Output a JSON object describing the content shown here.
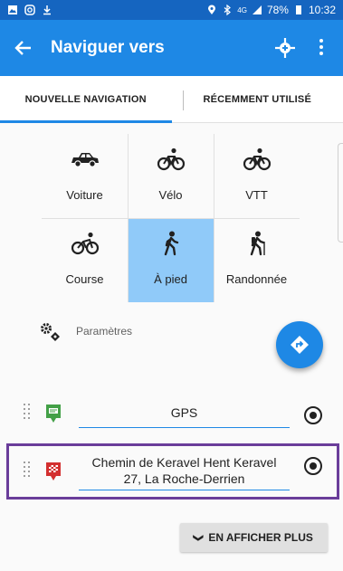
{
  "status_bar": {
    "time": "10:32",
    "battery": "78%",
    "network": "4G"
  },
  "app_bar": {
    "title": "Naviguer vers"
  },
  "tabs": [
    {
      "label": "NOUVELLE NAVIGATION",
      "active": true
    },
    {
      "label": "RÉCEMMENT UTILISÉ",
      "active": false
    }
  ],
  "modes": [
    {
      "label": "Voiture",
      "icon": "car-icon",
      "selected": false
    },
    {
      "label": "Vélo",
      "icon": "bicycle-icon",
      "selected": false
    },
    {
      "label": "VTT",
      "icon": "mountain-bike-icon",
      "selected": false
    },
    {
      "label": "Course",
      "icon": "cycling-icon",
      "selected": false
    },
    {
      "label": "À pied",
      "icon": "walking-icon",
      "selected": true
    },
    {
      "label": "Randonnée",
      "icon": "hiking-icon",
      "selected": false
    }
  ],
  "settings": {
    "label": "Paramètres"
  },
  "waypoints": [
    {
      "value": "GPS",
      "icon": "start-flag-icon"
    },
    {
      "value_line1": "Chemin de Keravel Hent Keravel",
      "value_line2": "27, La Roche-Derrien",
      "icon": "finish-flag-icon"
    }
  ],
  "show_more": {
    "label": "EN AFFICHER PLUS"
  },
  "colors": {
    "primary": "#1e88e5",
    "primary_dark": "#1565c0",
    "selected_mode": "#90caf9",
    "highlight_border": "#6a3d9a",
    "start_pin": "#43a047",
    "finish_pin": "#d32f2f"
  }
}
